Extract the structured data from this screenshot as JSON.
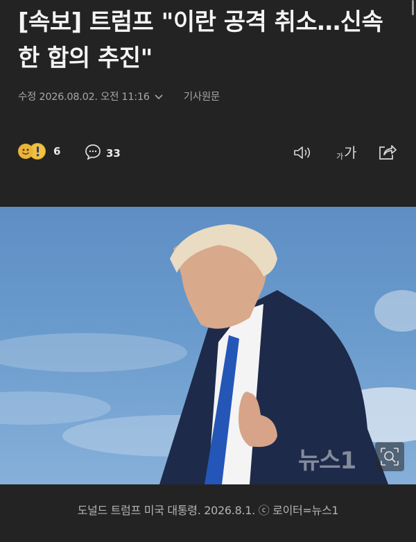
{
  "article": {
    "headline": "[속보] 트럼프 \"이란 공격 취소…신속한 합의 추진\"",
    "meta": {
      "modified_label": "수정",
      "datetime": "2026.08.02. 오전 11:16",
      "original_link": "기사원문"
    },
    "actions": {
      "reaction_count": "6",
      "comment_count": "33",
      "fontsize_small": "가",
      "fontsize_large": "가"
    },
    "photo": {
      "watermark": "뉴스1",
      "caption": "도널드 트럼프 미국 대통령. 2026.8.1. ⓒ 로이터=뉴스1"
    }
  }
}
